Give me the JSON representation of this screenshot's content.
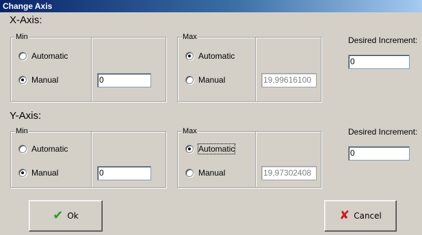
{
  "window": {
    "title": "Change Axis"
  },
  "x_axis": {
    "heading": "X-Axis:",
    "min": {
      "legend": "Min",
      "automatic_label": "Automatic",
      "manual_label": "Manual",
      "selected": "manual",
      "value": "0"
    },
    "max": {
      "legend": "Max",
      "automatic_label": "Automatic",
      "manual_label": "Manual",
      "selected": "automatic",
      "value": "19,99616100"
    },
    "increment": {
      "label": "Desired Increment:",
      "value": "0"
    }
  },
  "y_axis": {
    "heading": "Y-Axis:",
    "min": {
      "legend": "Min",
      "automatic_label": "Automatic",
      "manual_label": "Manual",
      "selected": "manual",
      "value": "0"
    },
    "max": {
      "legend": "Max",
      "automatic_label": "Automatic",
      "manual_label": "Manual",
      "selected": "automatic",
      "value": "19,97302408"
    },
    "increment": {
      "label": "Desired Increment:",
      "value": "0"
    }
  },
  "buttons": {
    "ok_label": "Ok",
    "cancel_label": "Cancel"
  },
  "colors": {
    "face": "#d4d0c8",
    "title_start": "#0a246a",
    "title_end": "#a6caf0",
    "ok_icon": "#2e9a1e",
    "cancel_icon": "#c81e1e"
  },
  "icons": {
    "ok": "checkmark-icon",
    "cancel": "x-icon"
  }
}
